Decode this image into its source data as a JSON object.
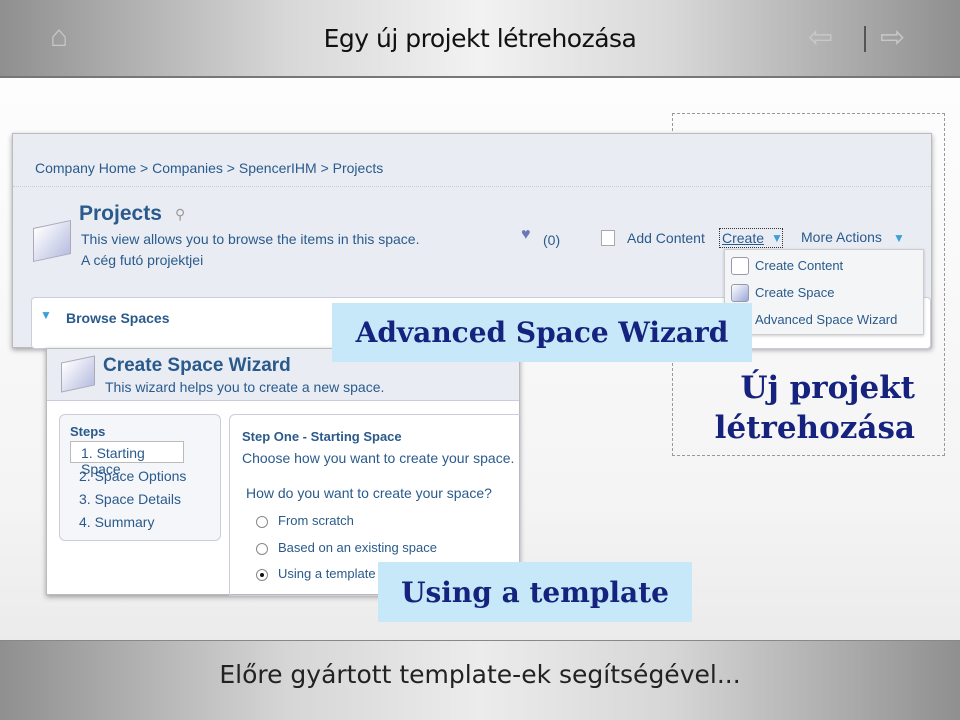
{
  "slide": {
    "title": "Egy új projekt létrehozása",
    "footer": "Előre gyártott template-ek segítségével...",
    "icons": [
      "home-icon",
      "arrow-left-icon",
      "arrow-right-icon"
    ]
  },
  "browser": {
    "breadcrumb": "Company Home > Companies > SpencerIHM > Projects",
    "space_title": "Projects",
    "description": "This view allows you to browse the items in this space.",
    "subtitle": "A cég futó projektjei",
    "count": "(0)",
    "add_content": "Add Content",
    "create": "Create",
    "more_actions": "More Actions",
    "browse_spaces": "Browse Spaces",
    "create_menu": [
      "Create Content",
      "Create Space",
      "Advanced Space Wizard"
    ]
  },
  "wizard": {
    "title": "Create Space Wizard",
    "description": "This wizard helps you to create a new space.",
    "steps_label": "Steps",
    "steps": [
      "1. Starting Space",
      "2. Space Options",
      "3. Space Details",
      "4. Summary"
    ],
    "step_title": "Step One - Starting Space",
    "step_desc": "Choose how you want to create your space.",
    "question": "How do you want to create your space?",
    "options": [
      "From scratch",
      "Based on an existing space",
      "Using a template"
    ],
    "selected_option": "Using a template"
  },
  "callouts": {
    "advanced": "Advanced Space Wizard",
    "new_project_1": "Új projekt",
    "new_project_2": "létrehozása",
    "template": "Using a template"
  },
  "colors": {
    "callout_bg": "#c6e8f8",
    "callout_text": "#15237e",
    "link": "#2a5a8c"
  }
}
